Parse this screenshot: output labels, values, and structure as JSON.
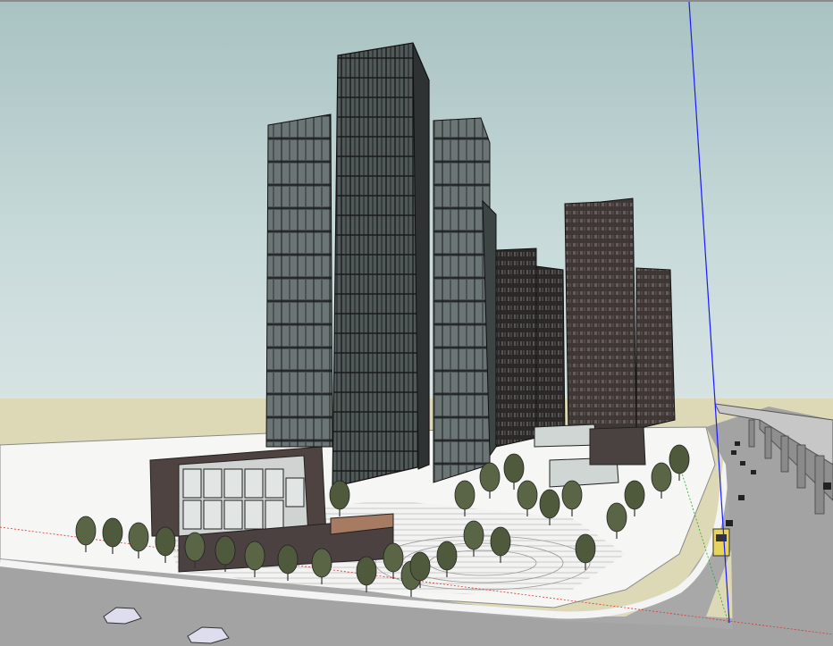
{
  "app": {
    "window_title": ""
  },
  "viewport": {
    "scene": "3d-urban-architecture-model",
    "sky_color": "#bcd0d0",
    "ground_color": "#ddd8b6",
    "road_color": "#a9a9a9",
    "axes": {
      "blue": "#1a1aff",
      "red": "#d33",
      "green": "#2a2"
    }
  }
}
